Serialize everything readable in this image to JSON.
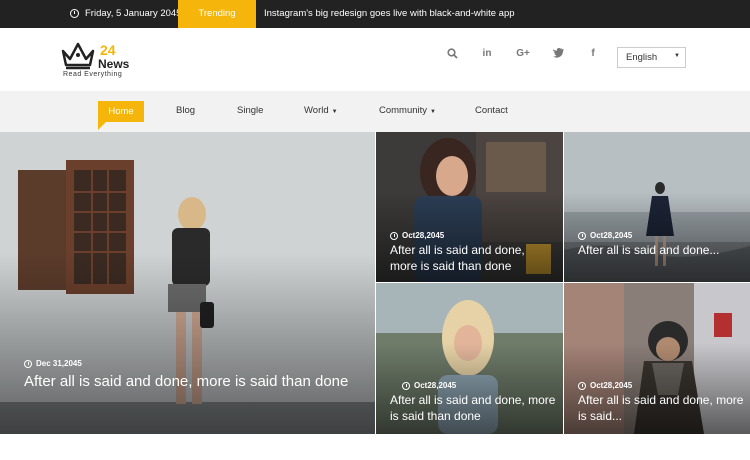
{
  "topbar": {
    "date": "Friday, 5 January 2045",
    "trending_label": "Trending",
    "ticker_text": "Instagram's big redesign goes live with black-and-white app"
  },
  "header": {
    "logo_number": "24",
    "logo_name": "News",
    "logo_tagline": "Read Everything",
    "social_icons": [
      "search-icon",
      "linkedin-icon",
      "google-plus-icon",
      "twitter-icon",
      "facebook-icon"
    ],
    "language": "English"
  },
  "nav": {
    "items": [
      "Home",
      "Blog",
      "Single",
      "World",
      "Community",
      "Contact"
    ]
  },
  "featured": {
    "main": {
      "date": "Dec 31,2045",
      "title": "After all is said and done, more is said than done"
    },
    "top_middle": {
      "date": "Oct28,2045",
      "title": "After all is said and done, more is said than done"
    },
    "top_right": {
      "date": "Oct28,2045",
      "title": "After all is said and done..."
    },
    "bottom_middle": {
      "date": "Oct28,2045",
      "title": "After all is said and done, more is said than done"
    },
    "bottom_right": {
      "date": "Oct28,2045",
      "title": "After all is said and done, more is said..."
    }
  },
  "colors": {
    "accent": "#f5b50a",
    "topbar_bg": "#222222",
    "nav_bg": "#f2f2f2"
  }
}
